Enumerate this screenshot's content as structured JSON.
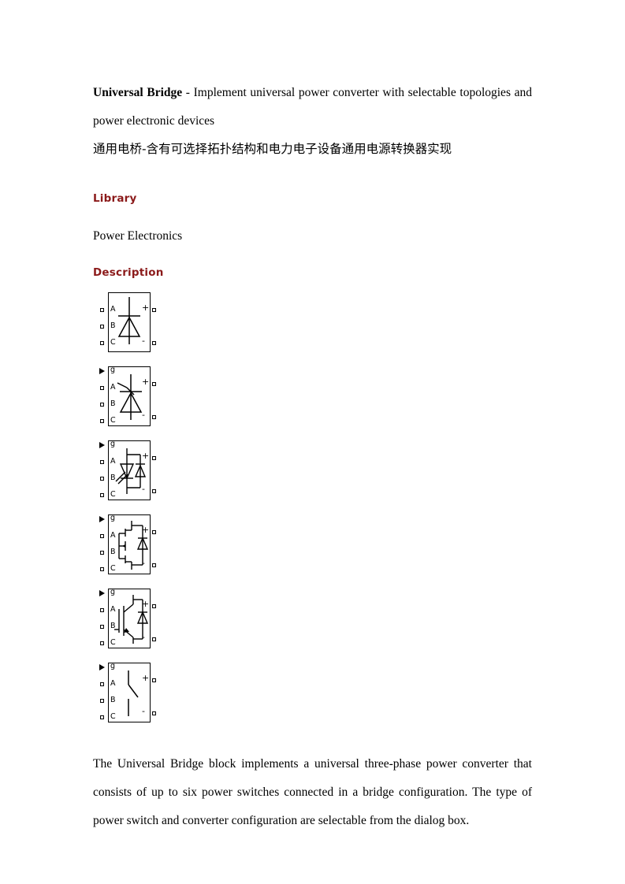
{
  "document": {
    "title_bold": "Universal Bridge",
    "title_rest": " - Implement universal power converter with selectable topologies and power electronic devices",
    "title_cn": "通用电桥-含有可选择拓扑结构和电力电子设备通用电源转换器实现",
    "sections": {
      "library_heading": "Library",
      "library_value": "Power Electronics",
      "description_heading": "Description"
    },
    "paragraph": "The Universal Bridge block implements a universal three-phase power converter that consists of up to six power switches connected in a bridge configuration. The type of power switch and converter configuration are selectable from the dialog box."
  },
  "diagram": {
    "blocks": [
      {
        "id": "diode-bridge",
        "device": "Diodes",
        "has_gate": false,
        "left_ports": [
          "A",
          "B",
          "C"
        ],
        "right_ports": [
          "+",
          "-"
        ]
      },
      {
        "id": "thyristor-bridge",
        "device": "Thyristors",
        "has_gate": true,
        "gate_label": "g",
        "left_ports": [
          "A",
          "B",
          "C"
        ],
        "right_ports": [
          "+",
          "-"
        ]
      },
      {
        "id": "gto-diode-bridge",
        "device": "GTO / Diodes",
        "has_gate": true,
        "gate_label": "g",
        "left_ports": [
          "A",
          "B",
          "C"
        ],
        "right_ports": [
          "+",
          "-"
        ]
      },
      {
        "id": "mosfet-diode-bridge",
        "device": "MOSFET / Diodes",
        "has_gate": true,
        "gate_label": "g",
        "left_ports": [
          "A",
          "B",
          "C"
        ],
        "right_ports": [
          "+",
          "-"
        ]
      },
      {
        "id": "igbt-diode-bridge",
        "device": "IGBT / Diodes",
        "has_gate": true,
        "gate_label": "g",
        "left_ports": [
          "A",
          "B",
          "C"
        ],
        "right_ports": [
          "+",
          "-"
        ]
      },
      {
        "id": "ideal-switch-bridge",
        "device": "Ideal Switches",
        "has_gate": true,
        "gate_label": "g",
        "left_ports": [
          "A",
          "B",
          "C"
        ],
        "right_ports": [
          "+",
          "-"
        ]
      }
    ]
  },
  "colors": {
    "heading": "#8b1a1a",
    "text": "#000000",
    "page_background": "#ffffff"
  }
}
